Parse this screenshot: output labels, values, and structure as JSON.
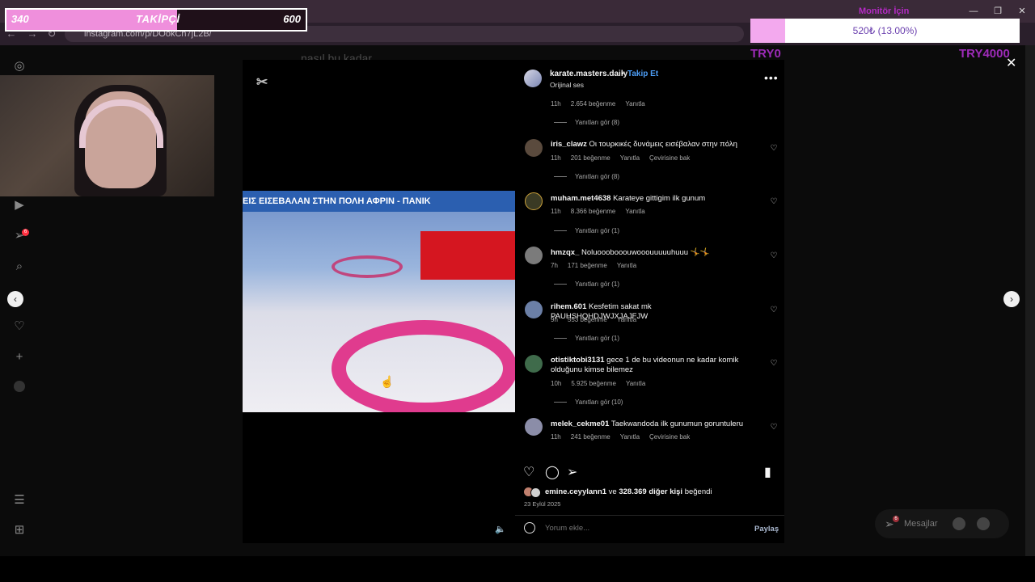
{
  "browser": {
    "url": "instagram.com/p/DOokCh7jL2B/",
    "nav": {
      "back": "←",
      "forward": "→",
      "reload": "↻"
    },
    "window": {
      "minimize": "—",
      "maximize": "❐",
      "close": "✕"
    }
  },
  "followers_goal": {
    "current": "340",
    "label": "TAKİPÇİ",
    "goal": "600",
    "progress": 0.57,
    "fill_color": "#ef8fdc"
  },
  "monitor_goal": {
    "title": "Monitör İçin",
    "amount_text": "520₺ (13.00%)",
    "progress": 0.13,
    "start_label": "TRY0",
    "end_label": "TRY4000",
    "fill_color": "#f3a9ee",
    "accent_color": "#9d2bb8"
  },
  "background_text": "nasıl bu kadar",
  "sidebar_icons": [
    "instagram-icon",
    "reels-icon",
    "direct-icon",
    "search-icon",
    "explore-icon",
    "heart-icon",
    "create-icon",
    "profile-icon",
    "menu-icon",
    "more-icon"
  ],
  "sidebar_badge": "6",
  "post": {
    "username": "karate.masters.daily",
    "separator": "•",
    "follow_label": "Takip Et",
    "audio": "Orijinal ses",
    "more": "•••",
    "video_caption": "ΕΙΣ ΕΙΣΕΒΑΛΑΝ ΣΤΗΝ ΠΟΛΗ ΑΦΡΙΝ - ΠΑΝΙΚ",
    "watermark_icon": "capcut-icon",
    "comments": [
      {
        "user": "",
        "text": "",
        "time": "11h",
        "likes": "2.654 beğenme",
        "reply": "Yanıtla",
        "translate": "",
        "replies": "Yanıtları gör (8)"
      },
      {
        "user": "iris_clawz",
        "text": "Οι τουρκικές δυνάμεις εισέβαλαν στην πόλη",
        "time": "11h",
        "likes": "201 beğenme",
        "reply": "Yanıtla",
        "translate": "Çevirisine bak",
        "replies": "Yanıtları gör (8)"
      },
      {
        "user": "muham.met4638",
        "text": "Karateye gittigim ilk gunum",
        "time": "11h",
        "likes": "8.366 beğenme",
        "reply": "Yanıtla",
        "translate": "",
        "replies": "Yanıtları gör (1)"
      },
      {
        "user": "hmzqx_",
        "text": "Noluooobooouwooouuuuuhuuu 🤸🤸",
        "time": "7h",
        "likes": "171 beğenme",
        "reply": "Yanıtla",
        "translate": "",
        "replies": "Yanıtları gör (1)"
      },
      {
        "user": "rihem.601",
        "text": "Kesfetim sakat mk PAUHSHQHDJWJXJAJFJW",
        "time": "9h",
        "likes": "553 beğenme",
        "reply": "Yanıtla",
        "translate": "",
        "replies": "Yanıtları gör (1)"
      },
      {
        "user": "otistiktobi3131",
        "text": "gece 1 de bu videonun ne kadar komik olduğunu kimse bilemez",
        "time": "10h",
        "likes": "5.925 beğenme",
        "reply": "Yanıtla",
        "translate": "",
        "replies": "Yanıtları gör (10)"
      },
      {
        "user": "melek_cekme01",
        "text": "Taekwandoda ilk gunumun goruntuleru",
        "time": "11h",
        "likes": "241 beğenme",
        "reply": "Yanıtla",
        "translate": "Çevirisine bak",
        "replies": ""
      }
    ],
    "likes_user": "emine.ceyylann1",
    "likes_and": " ve ",
    "likes_others": "328.369 diğer kişi",
    "likes_suffix": " beğendi",
    "date": "23 Eylül 2025",
    "comment_placeholder": "Yorum ekle...",
    "share_label": "Paylaş"
  },
  "messages": {
    "label": "Mesajlar",
    "badge": "6"
  }
}
